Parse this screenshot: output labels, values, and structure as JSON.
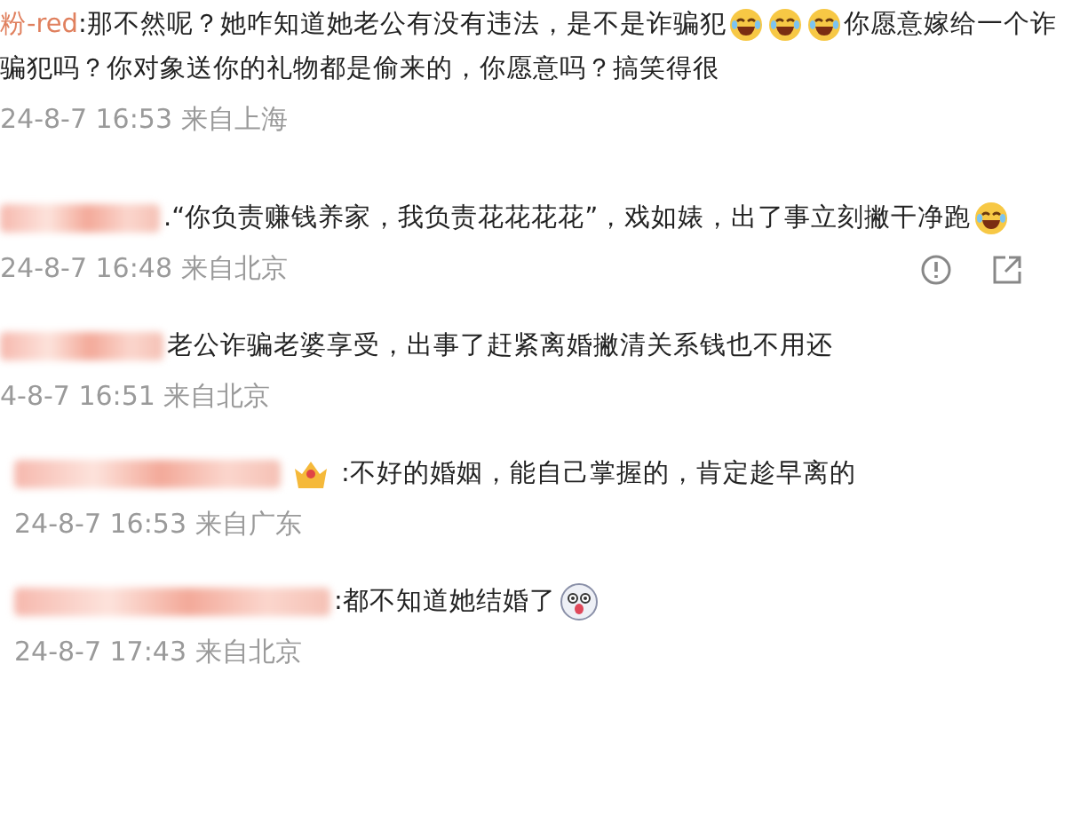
{
  "comments": [
    {
      "parts": [
        {
          "kind": "name",
          "text": "粉-red"
        },
        {
          "kind": "text",
          "text": ":那不然呢？她咋知道她老公有没有违法，是不是诈骗犯"
        },
        {
          "kind": "laugh"
        },
        {
          "kind": "laugh"
        },
        {
          "kind": "laugh"
        },
        {
          "kind": "text",
          "text": "你愿意嫁给一个诈骗犯吗？你对象送你的礼物都是偷来的，你愿意吗？搞笑得很"
        }
      ],
      "meta": "24-8-7 16:53 来自上海",
      "indent": false
    },
    {
      "parts": [
        {
          "kind": "blur"
        },
        {
          "kind": "text",
          "text": ".“你负责赚钱养家，我负责花花花花”，戏如婊，出了事立刻撇干净跑"
        },
        {
          "kind": "laugh"
        }
      ],
      "meta": "24-8-7 16:48 来自北京",
      "actions": true,
      "indent": false
    },
    {
      "parts": [
        {
          "kind": "blur"
        },
        {
          "kind": "text",
          "text": "老公诈骗老婆享受，出事了赶紧离婚撇清关系钱也不用还"
        }
      ],
      "meta": "4-8-7 16:51 来自北京",
      "indent": false
    },
    {
      "parts": [
        {
          "kind": "blur"
        },
        {
          "kind": "badge"
        },
        {
          "kind": "text",
          "text": ":不好的婚姻，能自己掌握的，肯定趁早离的"
        }
      ],
      "meta": "24-8-7 16:53 来自广东",
      "indent": true
    },
    {
      "parts": [
        {
          "kind": "blur"
        },
        {
          "kind": "text",
          "text": ":都不知道她结婚了"
        },
        {
          "kind": "dog"
        }
      ],
      "meta": "24-8-7 17:43 来自北京",
      "indent": true
    }
  ]
}
